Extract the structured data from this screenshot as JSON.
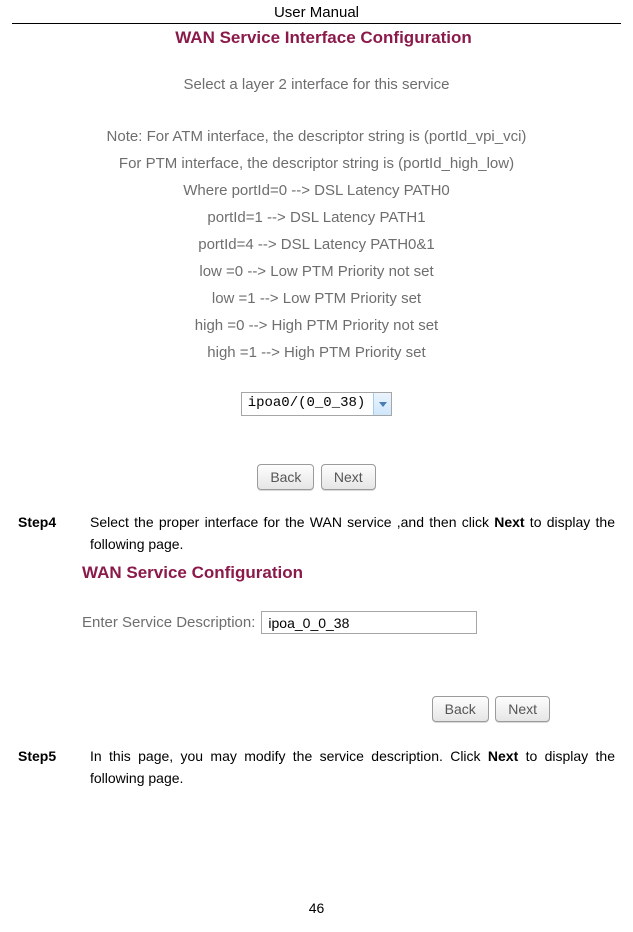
{
  "doc": {
    "header": "User Manual",
    "page": "46"
  },
  "figure1": {
    "title": "WAN Service Interface Configuration",
    "subtitle": "Select a layer 2 interface for this service",
    "notes": [
      "Note: For ATM interface, the descriptor string is (portId_vpi_vci)",
      "For PTM interface, the descriptor string is (portId_high_low)",
      "Where portId=0 --> DSL Latency PATH0",
      "portId=1 --> DSL Latency PATH1",
      "portId=4 --> DSL Latency PATH0&1",
      "low =0 --> Low PTM Priority not set",
      "low =1 --> Low PTM Priority set",
      "high =0 --> High PTM Priority not set",
      "high =1 --> High PTM Priority set"
    ],
    "select_value": "ipoa0/(0_0_38)",
    "back": "Back",
    "next": "Next"
  },
  "step4": {
    "label": "Step4",
    "pre": "Select the proper interface for the WAN service ,and then click ",
    "bold": "Next",
    "post": " to display the following page."
  },
  "figure2": {
    "title": "WAN Service Configuration",
    "field_label": "Enter Service Description:",
    "field_value": "ipoa_0_0_38",
    "back": "Back",
    "next": "Next"
  },
  "step5": {
    "label": "Step5",
    "pre": "In this page, you may modify the service description. Click ",
    "bold": "Next",
    "post": " to display the following page."
  }
}
